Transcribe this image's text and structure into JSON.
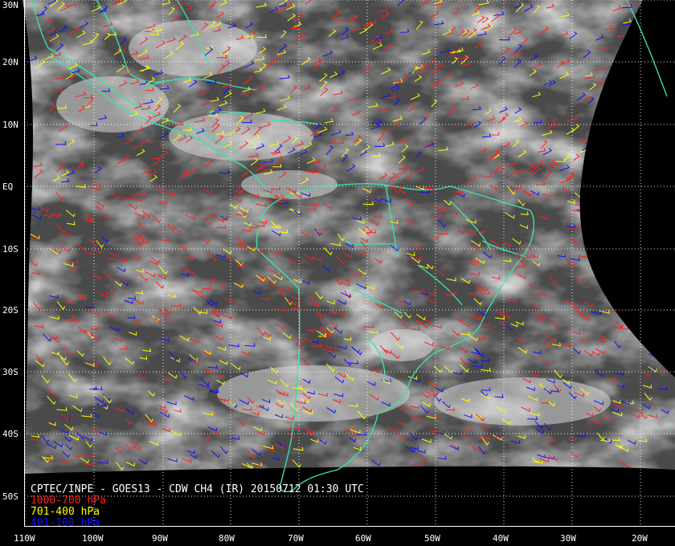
{
  "title": "CPTEC/INPE - GOES13 - CDW CH4 (IR) 20150712 01:30 UTC",
  "legend": [
    {
      "label": "1000-700 hPa",
      "color": "#ff2020"
    },
    {
      "label": "701-400 hPa",
      "color": "#ffff00"
    },
    {
      "label": "401-100 hPa",
      "color": "#1010ff"
    }
  ],
  "lat_labels": [
    "30N",
    "20N",
    "10N",
    "EQ",
    "10S",
    "20S",
    "30S",
    "40S",
    "50S"
  ],
  "lat_values": [
    30,
    20,
    10,
    0,
    -10,
    -20,
    -30,
    -40,
    -50
  ],
  "lon_labels": [
    "110W",
    "100W",
    "90W",
    "80W",
    "70W",
    "60W",
    "50W",
    "40W",
    "30W",
    "20W"
  ],
  "lon_values": [
    -110,
    -100,
    -90,
    -80,
    -70,
    -60,
    -50,
    -40,
    -30,
    -20
  ],
  "colors": {
    "coastline": "#3ce0a8",
    "grid": "#ffffff",
    "background": "#000000"
  }
}
